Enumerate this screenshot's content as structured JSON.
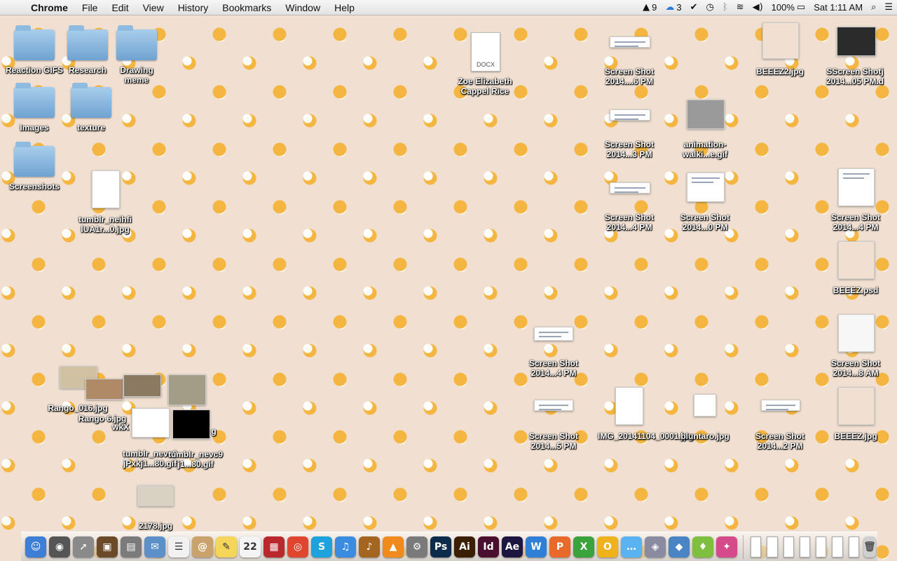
{
  "menubar": {
    "app_name": "Chrome",
    "menus": [
      "File",
      "Edit",
      "View",
      "History",
      "Bookmarks",
      "Window",
      "Help"
    ],
    "status": {
      "adobe_count": "9",
      "cc_count": "3",
      "battery": "100%",
      "clock": "Sat 1:11 AM"
    }
  },
  "desktop": {
    "folders": [
      "Reaction GIFS",
      "Research",
      "Drawing meme",
      "Images",
      "texture",
      "Screenshots"
    ],
    "files": {
      "docx_tag": "DOCX",
      "docx_name": "Zoe Elizabeth Cappel Rice",
      "tumblr_jpg": "tumblr_neihfi lUA1r...0.jpg",
      "shot1": "Screen Shot 2014....6 PM",
      "shot2": "Screen Shot 2014...3 PM",
      "shot3": "Screen Shot 2014...4 PM",
      "animation": "animation-walki...e.gif",
      "shot4": "Screen Shot 2014...0 PM",
      "beeez2": "BEEEZ2.jpg",
      "sscreen": "SScreen Shotj 2014...05 PM.d",
      "shot5": "Screen Shot 2014...4 PM",
      "beeez_psd": "BEEEZ.psd",
      "shot6": "Screen Shot 2014...4 PM",
      "shot7": "Screen Shot 2014...8 AM",
      "beeez_jpg": "BEEEZ.jpg",
      "img_scan": "IMG_20141104_0001.jpg",
      "bluntaro": "bluntaro.jpg",
      "shot8": "Screen Shot 2014...5 PM",
      "shot9": "Screen Shot 2014...2 PM",
      "rango016": "Rango_016.jpg",
      "rango6": "Rango 6.jpg",
      "wkx": "wkX",
      "tumblr_gif1": "tumblr_nevc9 jPxkj1...80.gif",
      "tumblr_gif2": "tumblr_nevc9 j1...80.gif",
      "g": "g",
      "file2178": "2178.jpg"
    }
  },
  "dock": {
    "apps": [
      {
        "name": "finder",
        "glyph": "☺",
        "color": "#3d7fd6"
      },
      {
        "name": "dashboard",
        "glyph": "◉",
        "color": "#555555"
      },
      {
        "name": "launchpad",
        "glyph": "➚",
        "color": "#8a8a8a"
      },
      {
        "name": "image-capture",
        "glyph": "▣",
        "color": "#6b4a2a"
      },
      {
        "name": "iphoto",
        "glyph": "▤",
        "color": "#7b7b7b"
      },
      {
        "name": "preview",
        "glyph": "✉",
        "color": "#5d8fc9"
      },
      {
        "name": "reminders",
        "glyph": "☰",
        "color": "#f1f1f1"
      },
      {
        "name": "contacts",
        "glyph": "@",
        "color": "#c9a36b"
      },
      {
        "name": "stickies",
        "glyph": "✎",
        "color": "#f5d55a"
      },
      {
        "name": "calendar",
        "glyph": "22",
        "color": "#f4f4f4"
      },
      {
        "name": "photo-booth",
        "glyph": "▦",
        "color": "#b8282c"
      },
      {
        "name": "chrome",
        "glyph": "◎",
        "color": "#e0452f"
      },
      {
        "name": "skype",
        "glyph": "S",
        "color": "#1ea2de"
      },
      {
        "name": "itunes",
        "glyph": "♫",
        "color": "#3a8ce0"
      },
      {
        "name": "garageband",
        "glyph": "♪",
        "color": "#a3651f"
      },
      {
        "name": "vlc",
        "glyph": "▲",
        "color": "#f08a1c"
      },
      {
        "name": "system-preferences",
        "glyph": "⚙",
        "color": "#7a7a7a"
      },
      {
        "name": "photoshop",
        "glyph": "Ps",
        "color": "#0d2b4a"
      },
      {
        "name": "illustrator",
        "glyph": "Ai",
        "color": "#3b1f05"
      },
      {
        "name": "indesign",
        "glyph": "Id",
        "color": "#4a0e2f"
      },
      {
        "name": "after-effects",
        "glyph": "Ae",
        "color": "#1d1640"
      },
      {
        "name": "word",
        "glyph": "W",
        "color": "#2f7fd6"
      },
      {
        "name": "powerpoint",
        "glyph": "P",
        "color": "#e8692a"
      },
      {
        "name": "excel",
        "glyph": "X",
        "color": "#3ba33b"
      },
      {
        "name": "outlook",
        "glyph": "O",
        "color": "#f0b21a"
      },
      {
        "name": "messages",
        "glyph": "…",
        "color": "#5ab3f0"
      },
      {
        "name": "image-viewer",
        "glyph": "◈",
        "color": "#8a8aa0"
      },
      {
        "name": "sketchup",
        "glyph": "◆",
        "color": "#4a84c4"
      },
      {
        "name": "sims",
        "glyph": "♦",
        "color": "#7fbf3f"
      },
      {
        "name": "paint-palette",
        "glyph": "✦",
        "color": "#d44a8a"
      }
    ],
    "trash_glyph": "🗑"
  }
}
